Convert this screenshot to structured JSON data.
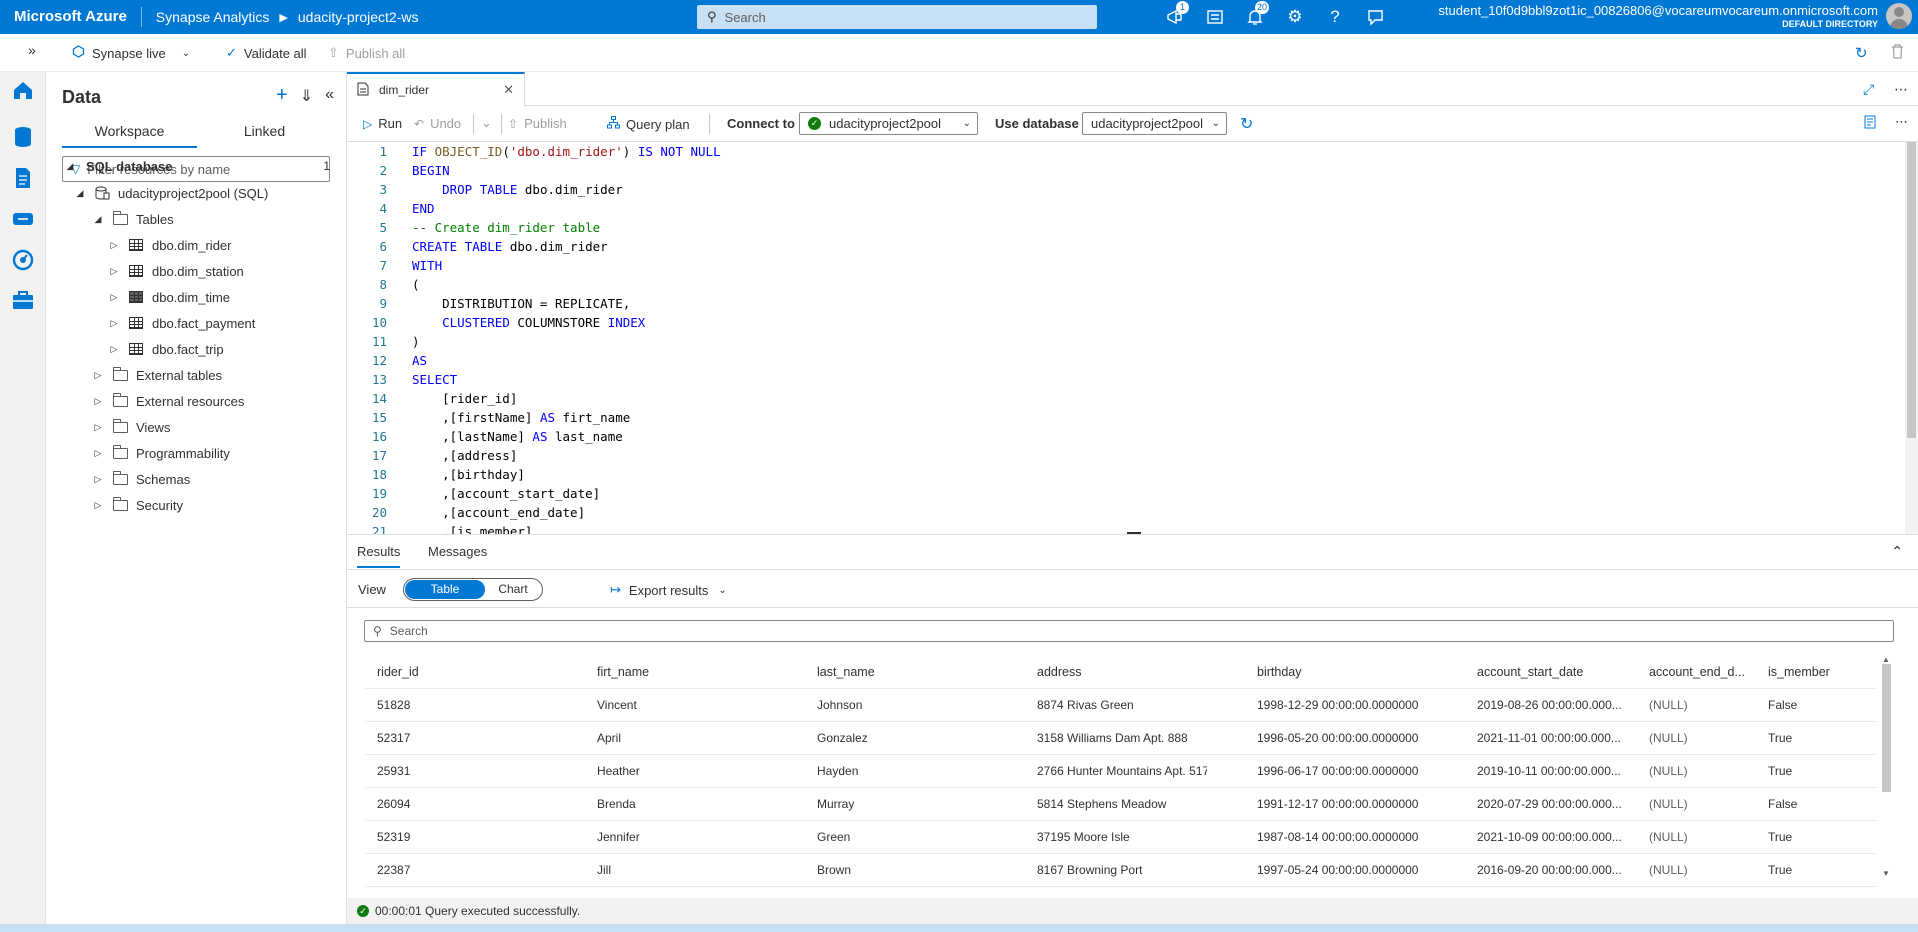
{
  "topbar": {
    "brand": "Microsoft Azure",
    "crumbs": [
      "Synapse Analytics",
      "udacity-project2-ws"
    ],
    "search_placeholder": "Search",
    "notifications_badge": "1",
    "alerts_badge": "20",
    "user_name": "student_10f0d9bbl9zot1ic_00826806@vocareumvocareum.onmicrosoft.com",
    "user_directory": "DEFAULT DIRECTORY"
  },
  "secbar": {
    "mode": "Synapse live",
    "validate_all": "Validate all",
    "publish_all": "Publish all"
  },
  "data_pane": {
    "title": "Data",
    "tabs": [
      "Workspace",
      "Linked"
    ],
    "filter_placeholder": "Filter resources by name",
    "tree": {
      "sql_database": "SQL database",
      "sql_database_count": "1",
      "pool": "udacityproject2pool (SQL)",
      "tables": "Tables",
      "table_items": [
        "dbo.dim_rider",
        "dbo.dim_station",
        "dbo.dim_time",
        "dbo.fact_payment",
        "dbo.fact_trip"
      ],
      "folders": [
        "External tables",
        "External resources",
        "Views",
        "Programmability",
        "Schemas",
        "Security"
      ]
    }
  },
  "editor": {
    "tab_name": "dim_rider",
    "toolbar": {
      "run": "Run",
      "undo": "Undo",
      "publish": "Publish",
      "query_plan": "Query plan",
      "connect_to_label": "Connect to",
      "connect_to_value": "udacityproject2pool",
      "use_database_label": "Use database",
      "use_database_value": "udacityproject2pool"
    },
    "line_numbers": [
      "1",
      "2",
      "3",
      "4",
      "5",
      "6",
      "7",
      "8",
      "9",
      "10",
      "11",
      "12",
      "13",
      "14",
      "15",
      "16",
      "17",
      "18",
      "19",
      "20",
      "21"
    ]
  },
  "results": {
    "tabs": [
      "Results",
      "Messages"
    ],
    "view_label": "View",
    "view_table": "Table",
    "view_chart": "Chart",
    "export": "Export results",
    "search_placeholder": "Search",
    "columns": [
      "rider_id",
      "firt_name",
      "last_name",
      "address",
      "birthday",
      "account_start_date",
      "account_end_d...",
      "is_member"
    ],
    "rows": [
      [
        "51828",
        "Vincent",
        "Johnson",
        "8874 Rivas Green",
        "1998-12-29 00:00:00.0000000",
        "2019-08-26 00:00:00.000...",
        "(NULL)",
        "False"
      ],
      [
        "52317",
        "April",
        "Gonzalez",
        "3158 Williams Dam Apt. 888",
        "1996-05-20 00:00:00.0000000",
        "2021-11-01 00:00:00.000...",
        "(NULL)",
        "True"
      ],
      [
        "25931",
        "Heather",
        "Hayden",
        "2766 Hunter Mountains Apt. 517",
        "1996-06-17 00:00:00.0000000",
        "2019-10-11 00:00:00.000...",
        "(NULL)",
        "True"
      ],
      [
        "26094",
        "Brenda",
        "Murray",
        "5814 Stephens Meadow",
        "1991-12-17 00:00:00.0000000",
        "2020-07-29 00:00:00.000...",
        "(NULL)",
        "False"
      ],
      [
        "52319",
        "Jennifer",
        "Green",
        "37195 Moore Isle",
        "1987-08-14 00:00:00.0000000",
        "2021-10-09 00:00:00.000...",
        "(NULL)",
        "True"
      ],
      [
        "22387",
        "Jill",
        "Brown",
        "8167 Browning Port",
        "1997-05-24 00:00:00.0000000",
        "2016-09-20 00:00:00.000...",
        "(NULL)",
        "True"
      ]
    ],
    "status": "00:00:01 Query executed successfully."
  }
}
